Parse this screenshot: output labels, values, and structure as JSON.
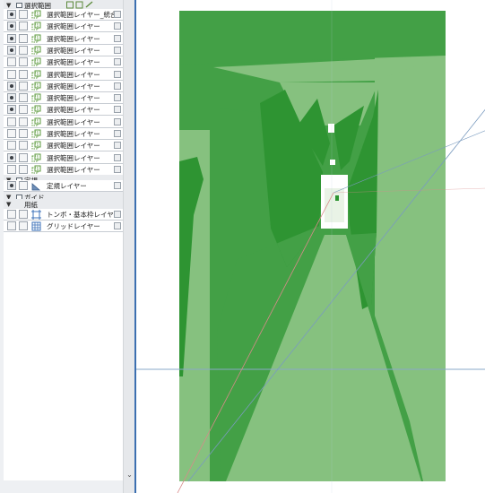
{
  "layer_panel": {
    "top_folder": {
      "label": "選択範囲"
    },
    "layers": [
      {
        "label": "選択範囲レイヤー_統合",
        "visible": true
      },
      {
        "label": "選択範囲レイヤー",
        "visible": true
      },
      {
        "label": "選択範囲レイヤー",
        "visible": true
      },
      {
        "label": "選択範囲レイヤー",
        "visible": true
      },
      {
        "label": "選択範囲レイヤー",
        "visible": false
      },
      {
        "label": "選択範囲レイヤー",
        "visible": false
      },
      {
        "label": "選択範囲レイヤー",
        "visible": true
      },
      {
        "label": "選択範囲レイヤー",
        "visible": true
      },
      {
        "label": "選択範囲レイヤー",
        "visible": true
      },
      {
        "label": "選択範囲レイヤー",
        "visible": false
      },
      {
        "label": "選択範囲レイヤー",
        "visible": false
      },
      {
        "label": "選択範囲レイヤー",
        "visible": false
      },
      {
        "label": "選択範囲レイヤー",
        "visible": true
      },
      {
        "label": "選択範囲レイヤー",
        "visible": false
      }
    ],
    "ruler_folder": {
      "label": "定規"
    },
    "ruler_layer": {
      "label": "定規レイヤー",
      "visible": true
    },
    "guide_folder": {
      "label": "ガイド"
    },
    "paper_folder": {
      "label": "用紙"
    },
    "tombo_layer": {
      "label": "トンボ・基本枠レイヤー"
    },
    "grid_layer": {
      "label": "グリッドレイヤー"
    }
  },
  "colors": {
    "accent": "#3c6fb0",
    "fill_dark": "#2e9432",
    "fill_medium": "#43a046",
    "fill_light": "#86c17f"
  }
}
